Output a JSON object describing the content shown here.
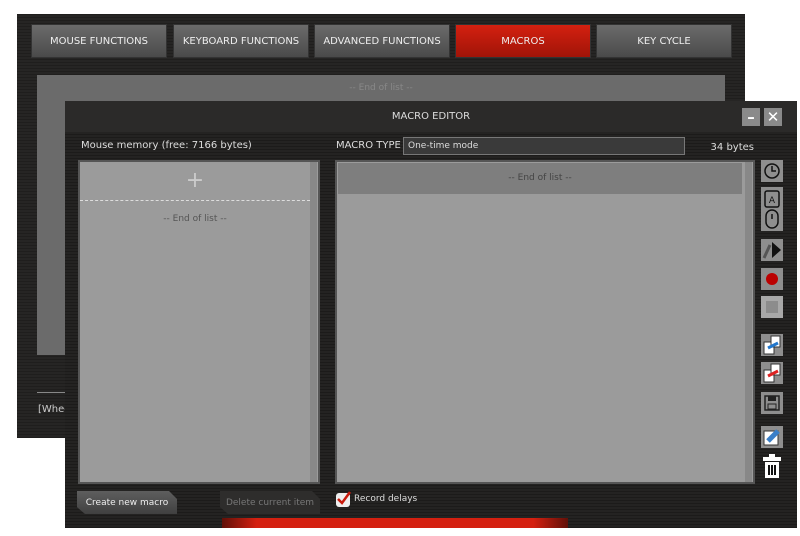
{
  "back_window": {
    "tabs": [
      {
        "label": "MOUSE FUNCTIONS"
      },
      {
        "label": "KEYBOARD FUNCTIONS"
      },
      {
        "label": "ADVANCED FUNCTIONS"
      },
      {
        "label": "MACROS",
        "active": true
      },
      {
        "label": "KEY CYCLE"
      }
    ],
    "end_of_list": "-- End of list --",
    "partial_text": "[Whee"
  },
  "editor": {
    "title": "MACRO EDITOR",
    "minimize": "–",
    "close": "✕",
    "memory_label": "Mouse memory (free: 7166 bytes)",
    "macro_type_label": "MACRO TYPE",
    "macro_type_value": "One-time mode",
    "bytes": "34 bytes",
    "left_list": {
      "add": "+",
      "end_of_list": "-- End of list --"
    },
    "right_list": {
      "end_of_list": "-- End of list --"
    },
    "tools": [
      "clock-icon",
      "keyboard-key-icon",
      "mouse-icon",
      "cursor-move-icon",
      "record-icon",
      "stop-icon",
      "import-icon",
      "export-icon",
      "save-icon",
      "edit-icon",
      "trash-icon"
    ],
    "create_button": "Create new macro",
    "delete_button": "Delete current item",
    "record_delays_label": "Record delays",
    "record_delays_checked": true
  },
  "colors": {
    "accent": "#c81a0c"
  }
}
